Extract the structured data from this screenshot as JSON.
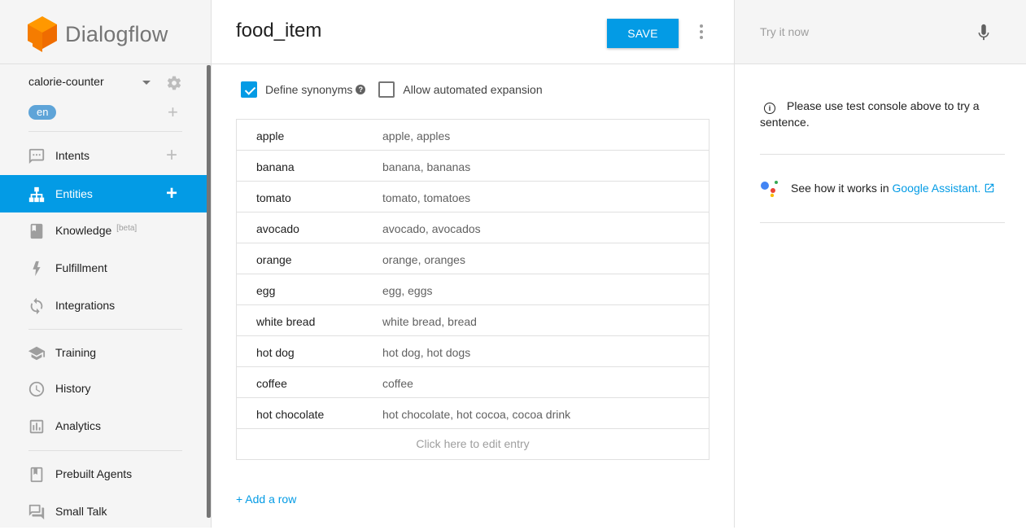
{
  "app": {
    "name": "Dialogflow"
  },
  "agent": {
    "name": "calorie-counter",
    "language": "en"
  },
  "nav": {
    "intents": "Intents",
    "entities": "Entities",
    "knowledge": "Knowledge",
    "knowledge_badge": "[beta]",
    "fulfillment": "Fulfillment",
    "integrations": "Integrations",
    "training": "Training",
    "history": "History",
    "analytics": "Analytics",
    "prebuilt_agents": "Prebuilt Agents",
    "small_talk": "Small Talk"
  },
  "entity": {
    "title": "food_item",
    "save_label": "SAVE",
    "define_synonyms": {
      "label": "Define synonyms",
      "checked": true
    },
    "automated_expansion": {
      "label": "Allow automated expansion",
      "checked": false
    },
    "rows": [
      {
        "reference": "apple",
        "synonyms": "apple, apples"
      },
      {
        "reference": "banana",
        "synonyms": "banana, bananas"
      },
      {
        "reference": "tomato",
        "synonyms": "tomato, tomatoes"
      },
      {
        "reference": "avocado",
        "synonyms": "avocado, avocados"
      },
      {
        "reference": "orange",
        "synonyms": "orange, oranges"
      },
      {
        "reference": "egg",
        "synonyms": "egg, eggs"
      },
      {
        "reference": "white bread",
        "synonyms": "white bread, bread"
      },
      {
        "reference": "hot dog",
        "synonyms": "hot dog, hot dogs"
      },
      {
        "reference": "coffee",
        "synonyms": "coffee"
      },
      {
        "reference": "hot chocolate",
        "synonyms": "hot chocolate, hot cocoa, cocoa drink"
      }
    ],
    "edit_placeholder": "Click here to edit entry",
    "add_row": "+ Add a row"
  },
  "console": {
    "placeholder": "Try it now",
    "info": "Please use test console above to try a sentence.",
    "assistant_prefix": "See how it works in ",
    "assistant_link": "Google Assistant."
  },
  "colors": {
    "accent": "#039be5",
    "sidebar_bg": "#f5f5f5",
    "logo_orange": "#ff9800"
  }
}
